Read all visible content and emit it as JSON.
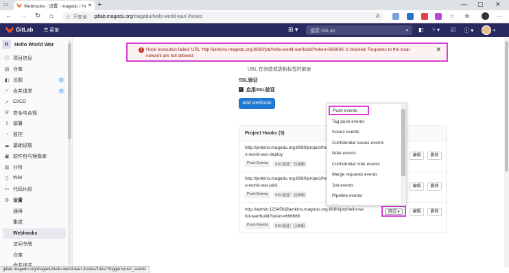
{
  "browser": {
    "tab_title": "Webhooks · 设置 · magedu / Hello",
    "insecure_label": "不安全",
    "url_host": "gitlab.magedu.org",
    "url_path": "/magedu/hello-world-war/-/hooks",
    "status_url": "gitlab.magedu.org/magedu/hello-world-war/-/hooks/1/test?trigger=push_events"
  },
  "gitlab": {
    "brand": "GitLab",
    "menu_label": "菜单",
    "search_placeholder": "搜索 GitLab"
  },
  "sidebar": {
    "project_initial": "H",
    "project_name": "Hello World War",
    "items": [
      {
        "label": "项目信息",
        "icon": "info-icon"
      },
      {
        "label": "仓库",
        "icon": "repo-icon"
      },
      {
        "label": "议题",
        "icon": "issues-icon",
        "count": "0"
      },
      {
        "label": "合并请求",
        "icon": "merge-request-icon",
        "count": "0"
      },
      {
        "label": "CI/CD",
        "icon": "rocket-icon"
      },
      {
        "label": "安全与合规",
        "icon": "shield-icon"
      },
      {
        "label": "部署",
        "icon": "deploy-icon"
      },
      {
        "label": "监控",
        "icon": "monitor-icon"
      },
      {
        "label": "基础设施",
        "icon": "cloud-icon"
      },
      {
        "label": "软件包与镜像库",
        "icon": "package-icon"
      },
      {
        "label": "分析",
        "icon": "chart-icon"
      },
      {
        "label": "Wiki",
        "icon": "book-icon"
      },
      {
        "label": "代码片段",
        "icon": "snippet-icon"
      },
      {
        "label": "设置",
        "icon": "gear-icon"
      }
    ],
    "sub_items": [
      "通用",
      "集成",
      "Webhooks",
      "访问令牌",
      "仓库",
      "合并请求"
    ]
  },
  "alert": {
    "message": "Hook execution failed: URL 'http://jenkins.magedu.org:8080/job/hello-world-war/build?token=666666' is blocked: Requests to the local network are not allowed"
  },
  "form": {
    "url_note": "URL 在创建或更新标签时触发",
    "ssl_heading": "SSL验证",
    "ssl_checkbox_label": "启用SSL验证",
    "add_button": "Add webhook"
  },
  "project_hooks": {
    "heading": "Project Hooks (3)",
    "hooks": [
      {
        "url": "http://jenkins.magedu.org:8080/project/hello-world-war-deploy",
        "event": "Push Events",
        "ssl": "SSL验证：已启用"
      },
      {
        "url": "http://jenkins.magedu.org:8080/project/hello-world-war-job1",
        "event": "Push Events",
        "ssl": "SSL验证：已启用"
      },
      {
        "url": "http://admin:123456@jenkins.magedu.org:8080/job/hello-world-war/build?token=666666",
        "event": "Push Events",
        "ssl": "SSL验证：已启用"
      }
    ],
    "test_label": "测试",
    "edit_label": "编辑",
    "delete_label": "删除"
  },
  "test_dropdown": {
    "options": [
      "Push events",
      "Tag push events",
      "Issues events",
      "Confidential issues events",
      "Note events",
      "Confidential note events",
      "Merge requests events",
      "Job events",
      "Pipeline events",
      "Wiki page events"
    ],
    "selected": "Push events"
  },
  "colors": {
    "header_bg": "#292961",
    "primary_button": "#1f78d1",
    "highlight": "#d63cd6",
    "alert_bg": "#fdf1f1"
  }
}
